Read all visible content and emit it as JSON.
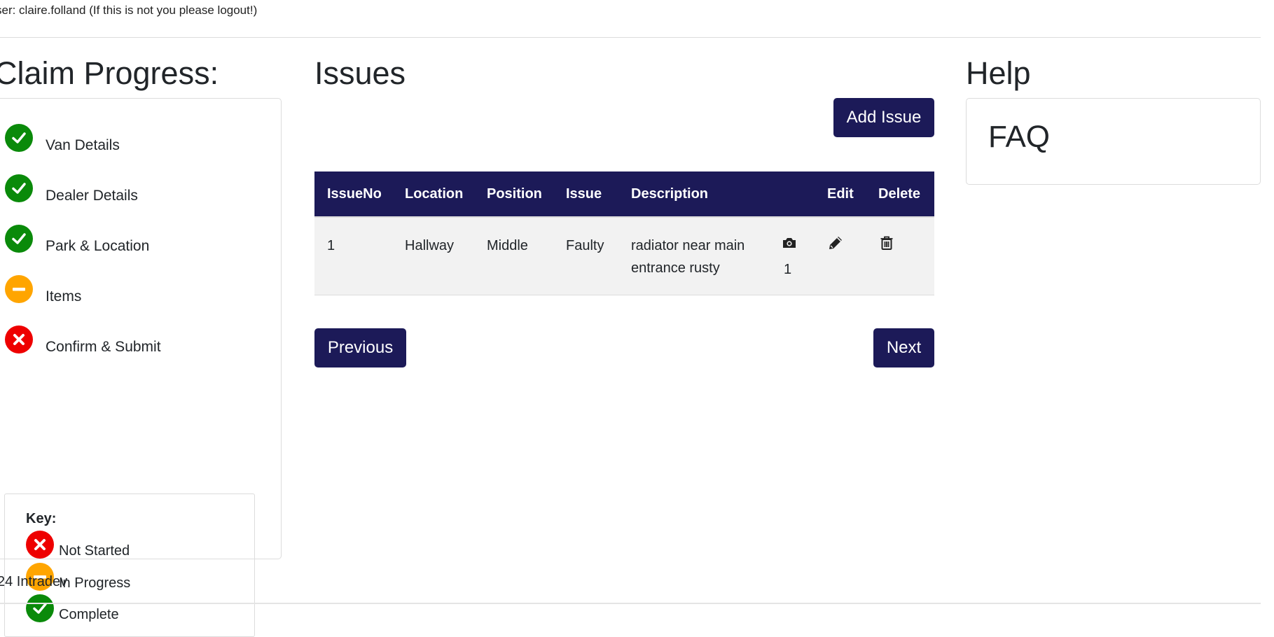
{
  "header": {
    "user_text": "ser: claire.folland (If this is not you please logout!)"
  },
  "claim_progress": {
    "title": "Claim Progress:",
    "steps": [
      {
        "label": "Van Details",
        "status": "complete"
      },
      {
        "label": "Dealer Details",
        "status": "complete"
      },
      {
        "label": "Park & Location",
        "status": "complete"
      },
      {
        "label": "Items",
        "status": "in-progress"
      },
      {
        "label": "Confirm & Submit",
        "status": "not-started"
      }
    ],
    "key": {
      "title": "Key:",
      "items": [
        {
          "label": "Not Started",
          "status": "not-started"
        },
        {
          "label": "In Progress",
          "status": "in-progress"
        },
        {
          "label": "Complete",
          "status": "complete"
        }
      ]
    }
  },
  "issues": {
    "title": "Issues",
    "add_button": "Add Issue",
    "columns": [
      "IssueNo",
      "Location",
      "Position",
      "Issue",
      "Description",
      "",
      "Edit",
      "Delete"
    ],
    "rows": [
      {
        "issue_no": "1",
        "location": "Hallway",
        "position": "Middle",
        "issue": "Faulty",
        "description": "radiator near main entrance rusty",
        "photo_count": "1",
        "photo_icon": "camera-icon",
        "edit_icon": "pencil-icon",
        "delete_icon": "trash-icon"
      }
    ],
    "previous_button": "Previous",
    "next_button": "Next"
  },
  "help": {
    "title": "Help",
    "faq_title": "FAQ"
  },
  "footer": {
    "text": "24 Intradev"
  },
  "colors": {
    "primary": "#1c1a58",
    "complete": "#0a8a0a",
    "in_progress": "#ffa500",
    "not_started": "#ee0000",
    "row_background": "#f2f2f2"
  }
}
